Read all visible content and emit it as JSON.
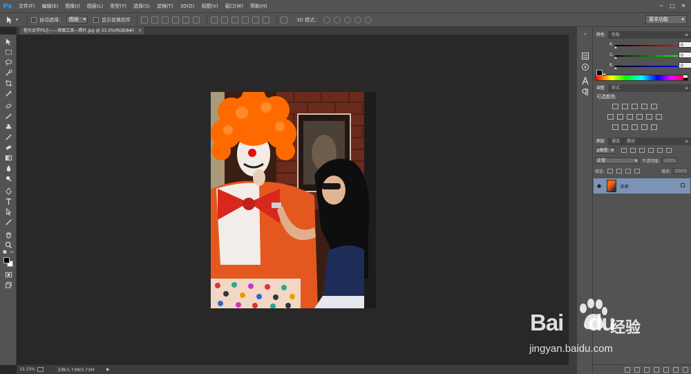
{
  "app": {
    "logo": "Ps",
    "menu": [
      "文件(F)",
      "编辑(E)",
      "图像(I)",
      "图层(L)",
      "类型(Y)",
      "选择(S)",
      "滤镜(T)",
      "3D(D)",
      "视图(V)",
      "窗口(W)",
      "帮助(H)"
    ],
    "window_controls": [
      "─",
      "□",
      "✕"
    ]
  },
  "options": {
    "auto_select_label": "自动选择：",
    "auto_select_value": "图层",
    "show_transform_label": "显示变换控件",
    "mode3d_label": "3D 模式：",
    "workspace": "基本功能"
  },
  "document": {
    "tab_title": "程大太学PS之——修图工具—照片.jpg @ 33.3%(RGB/8#)",
    "tab_close": "×"
  },
  "status": {
    "zoom": "33.33%",
    "doc_info": "文档:5.73M/5.73M",
    "arrow": "▶"
  },
  "color_panel": {
    "tabs": [
      "颜色",
      "色板"
    ],
    "channels": [
      {
        "label": "R",
        "value": "0",
        "color": "#d83030"
      },
      {
        "label": "G",
        "value": "0",
        "color": "#2fb82f"
      },
      {
        "label": "B",
        "value": "0",
        "color": "#3050e0"
      }
    ],
    "menu": "≡"
  },
  "adjustments_panel": {
    "tabs": [
      "调整",
      "样式"
    ],
    "title": "可选颜色",
    "menu": "≡"
  },
  "layers_panel": {
    "tabs": [
      "图层",
      "通道",
      "路径"
    ],
    "filter_kind": "ρ类型",
    "blend_mode": "正常",
    "opacity_label": "不透明度:",
    "opacity_value": "100%",
    "lock_label": "锁定:",
    "fill_label": "填充:",
    "fill_value": "100%",
    "layer_name": "背景",
    "menu": "≡"
  },
  "watermark": {
    "brand": "Bai",
    "brand_suffix": "du",
    "cn": "经验",
    "url": "jingyan.baidu.com"
  },
  "colors": {
    "accent": "#31a8ff",
    "layer_selected": "#7b93b5"
  }
}
